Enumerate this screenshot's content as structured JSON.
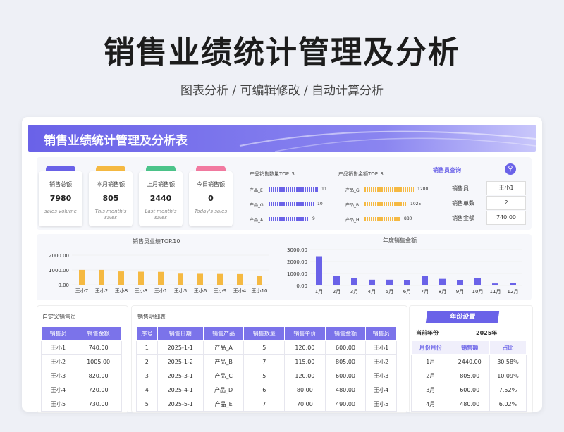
{
  "poster": {
    "title": "销售业绩统计管理及分析",
    "subtitle": "图表分析 /  可编辑修改  / 自动计算分析"
  },
  "banner": {
    "title": "销售业绩统计管理及分析表"
  },
  "kpi_cards": [
    {
      "label": "销售总额",
      "value": "7980",
      "sub": "sales volume",
      "color": "#6a62e8"
    },
    {
      "label": "本月销售额",
      "value": "805",
      "sub": "This month's sales",
      "color": "#f5b942"
    },
    {
      "label": "上月销售额",
      "value": "2440",
      "sub": "Last month's sales",
      "color": "#4cc48a"
    },
    {
      "label": "今日销售额",
      "value": "0",
      "sub": "Today's sales",
      "color": "#f27aa0"
    }
  ],
  "top_qty": {
    "title": "产品销售数量TOP. 3",
    "color": "#6a62e8",
    "items": [
      {
        "name": "产品_E",
        "value": 11
      },
      {
        "name": "产品_G",
        "value": 10
      },
      {
        "name": "产品_A",
        "value": 9
      }
    ]
  },
  "top_amount": {
    "title": "产品销售金额TOP. 3",
    "color": "#f5b942",
    "items": [
      {
        "name": "产品_G",
        "value": 1200
      },
      {
        "name": "产品_B",
        "value": 1025
      },
      {
        "name": "产品_H",
        "value": 880
      }
    ]
  },
  "query": {
    "title": "销售员查询",
    "fields": [
      {
        "label": "销售员",
        "value": "王小1"
      },
      {
        "label": "销售单数",
        "value": "2"
      },
      {
        "label": "销售金额",
        "value": "740.00"
      }
    ]
  },
  "chart_data": [
    {
      "type": "bar",
      "title": "销售员业绩TOP.10",
      "categories": [
        "王小7",
        "王小2",
        "王小8",
        "王小3",
        "王小1",
        "王小5",
        "王小6",
        "王小9",
        "王小4",
        "王小10"
      ],
      "values": [
        1005,
        1005,
        900,
        880,
        870,
        750,
        740,
        730,
        720,
        620
      ],
      "yticks": [
        "2000.00",
        "1000.00",
        "0.00"
      ],
      "ylim": [
        0,
        2000
      ],
      "color": "#f5b942"
    },
    {
      "type": "bar",
      "title": "年度销售金额",
      "categories": [
        "1月",
        "2月",
        "3月",
        "4月",
        "5月",
        "6月",
        "7月",
        "8月",
        "9月",
        "10月",
        "11月",
        "12月"
      ],
      "values": [
        2440,
        805,
        600,
        480,
        480,
        430,
        820,
        550,
        440,
        600,
        170,
        230
      ],
      "yticks": [
        "3000.00",
        "2000.00",
        "1000.00",
        "0.00"
      ],
      "ylim": [
        0,
        3000
      ],
      "color": "#6a62e8"
    }
  ],
  "custom_sales": {
    "title": "自定义销售员",
    "headers": [
      "销售员",
      "销售金额"
    ],
    "rows": [
      [
        "王小1",
        "740.00"
      ],
      [
        "王小2",
        "1005.00"
      ],
      [
        "王小3",
        "820.00"
      ],
      [
        "王小4",
        "720.00"
      ],
      [
        "王小5",
        "730.00"
      ]
    ]
  },
  "detail": {
    "title": "销售明细表",
    "headers": [
      "序号",
      "销售日期",
      "销售产品",
      "销售数量",
      "销售单价",
      "销售金额",
      "销售员"
    ],
    "rows": [
      [
        "1",
        "2025-1-1",
        "产品_A",
        "5",
        "120.00",
        "600.00",
        "王小1"
      ],
      [
        "2",
        "2025-1-2",
        "产品_B",
        "7",
        "115.00",
        "805.00",
        "王小2"
      ],
      [
        "3",
        "2025-3-1",
        "产品_C",
        "5",
        "120.00",
        "600.00",
        "王小3"
      ],
      [
        "4",
        "2025-4-1",
        "产品_D",
        "6",
        "80.00",
        "480.00",
        "王小4"
      ],
      [
        "5",
        "2025-5-1",
        "产品_E",
        "7",
        "70.00",
        "490.00",
        "王小5"
      ]
    ]
  },
  "year": {
    "tab": "年份设置",
    "current_label": "当前年份",
    "current_value": "2025年",
    "headers": [
      "月份月份",
      "销售额",
      "占比"
    ],
    "rows": [
      [
        "1月",
        "2440.00",
        "30.58%"
      ],
      [
        "2月",
        "805.00",
        "10.09%"
      ],
      [
        "3月",
        "600.00",
        "7.52%"
      ],
      [
        "4月",
        "480.00",
        "6.02%"
      ]
    ]
  }
}
